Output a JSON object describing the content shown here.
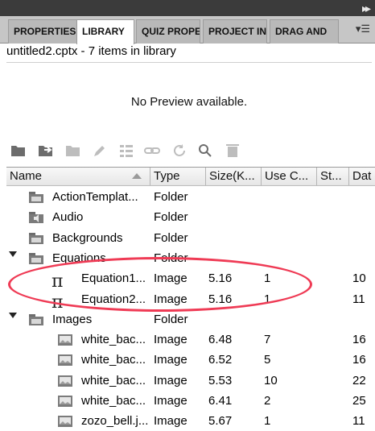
{
  "tabs": [
    {
      "label": "PROPERTIES",
      "active": false
    },
    {
      "label": "LIBRARY",
      "active": true
    },
    {
      "label": "QUIZ PROPERTIES",
      "active": false
    },
    {
      "label": "PROJECT INFO",
      "active": false
    },
    {
      "label": "DRAG AND",
      "active": false
    }
  ],
  "library": {
    "header": "untitled2.cptx - 7 items in library",
    "preview": "No Preview available."
  },
  "toolbar": {
    "icons": [
      "open-folder-icon",
      "import-icon",
      "export-icon",
      "edit-icon",
      "properties-icon",
      "link-icon",
      "refresh-icon",
      "usage-icon",
      "delete-icon"
    ]
  },
  "columns": {
    "name": "Name",
    "type": "Type",
    "size": "Size(K...",
    "use": "Use C...",
    "status": "St...",
    "date": "Dat"
  },
  "rows": [
    {
      "name": "ActionTemplat...",
      "type": "Folder",
      "size": "",
      "use": "",
      "date": "",
      "icon": "folder-icon",
      "level": 0,
      "expander": false
    },
    {
      "name": "Audio",
      "type": "Folder",
      "size": "",
      "use": "",
      "date": "",
      "icon": "audio-folder-icon",
      "level": 0,
      "expander": false
    },
    {
      "name": "Backgrounds",
      "type": "Folder",
      "size": "",
      "use": "",
      "date": "",
      "icon": "folder-icon",
      "level": 0,
      "expander": false
    },
    {
      "name": "Equations",
      "type": "Folder",
      "size": "",
      "use": "",
      "date": "",
      "icon": "folder-icon",
      "level": 0,
      "expander": true
    },
    {
      "name": "Equation1...",
      "type": "Image",
      "size": "5.16",
      "use": "1",
      "date": "10",
      "icon": "pi-icon",
      "level": 1,
      "expander": false
    },
    {
      "name": "Equation2...",
      "type": "Image",
      "size": "5.16",
      "use": "1",
      "date": "11",
      "icon": "pi-icon",
      "level": 1,
      "expander": false
    },
    {
      "name": "Images",
      "type": "Folder",
      "size": "",
      "use": "",
      "date": "",
      "icon": "folder-icon",
      "level": 0,
      "expander": true
    },
    {
      "name": "white_bac...",
      "type": "Image",
      "size": "6.48",
      "use": "7",
      "date": "16",
      "icon": "image-icon",
      "level": 1,
      "expander": false
    },
    {
      "name": "white_bac...",
      "type": "Image",
      "size": "6.52",
      "use": "5",
      "date": "16",
      "icon": "image-icon",
      "level": 1,
      "expander": false
    },
    {
      "name": "white_bac...",
      "type": "Image",
      "size": "5.53",
      "use": "10",
      "date": "22",
      "icon": "image-icon",
      "level": 1,
      "expander": false
    },
    {
      "name": "white_bac...",
      "type": "Image",
      "size": "6.41",
      "use": "2",
      "date": "25",
      "icon": "image-icon",
      "level": 1,
      "expander": false
    },
    {
      "name": "zozo_bell.j...",
      "type": "Image",
      "size": "5.67",
      "use": "1",
      "date": "11",
      "icon": "image-icon",
      "level": 1,
      "expander": false
    }
  ],
  "colors": {
    "callout": "#ef3b55",
    "tab_inactive": "#b9b9b9",
    "tab_active": "#ffffff",
    "dark_strip": "#3b3b3b"
  }
}
